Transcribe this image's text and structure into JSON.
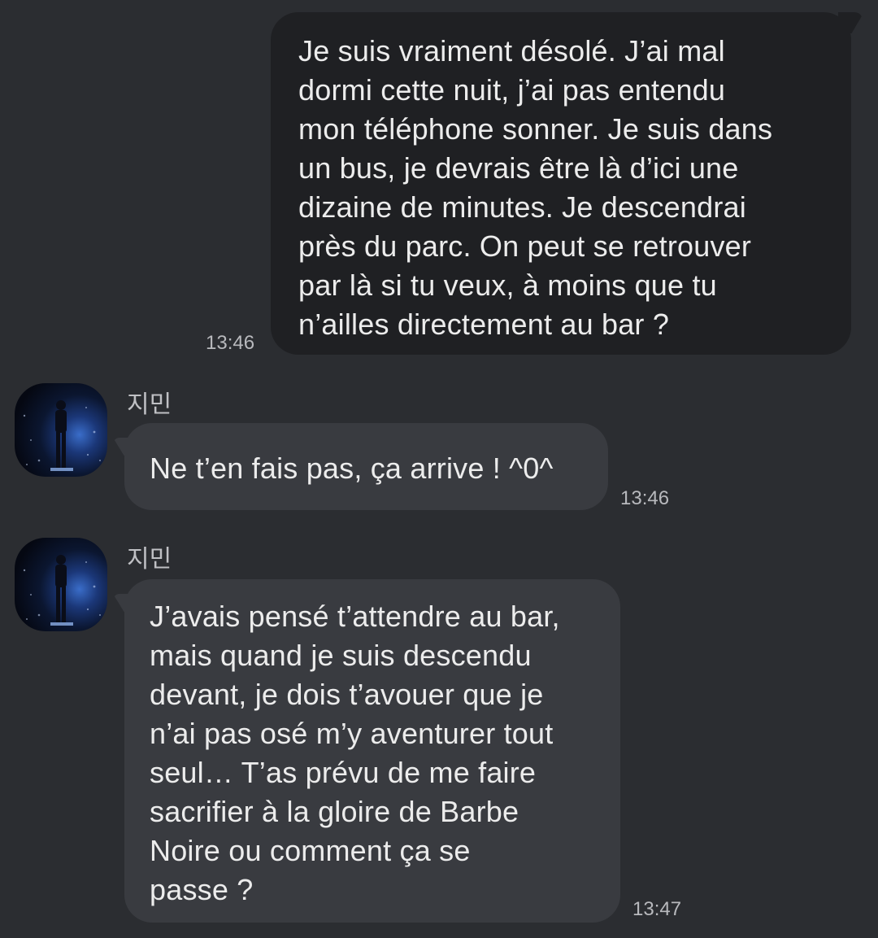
{
  "conversation": {
    "messages": [
      {
        "direction": "outgoing",
        "text": "Je suis vraiment désolé. J’ai mal\ndormi cette nuit, j’ai pas entendu\nmon téléphone sonner. Je suis dans\nun bus, je devrais être là d’ici une\ndizaine de minutes. Je descendrai\nprès du parc. On peut se retrouver\npar là si tu veux, à moins que tu\nn’ailles directement au bar ?",
        "time": "13:46"
      },
      {
        "direction": "incoming",
        "sender": "지민",
        "avatar_icon": "profile-avatar-icon",
        "text": "Ne t’en fais pas, ça arrive ! ^0^",
        "time": "13:46"
      },
      {
        "direction": "incoming",
        "sender": "지민",
        "avatar_icon": "profile-avatar-icon",
        "text": "J’avais pensé t’attendre au bar,\nmais quand je suis descendu\ndevant, je dois t’avouer que je\nn’ai pas osé m’y aventurer tout\nseul… T’as prévu de me faire\nsacrifier à la gloire de Barbe\nNoire ou comment ça se\npasse ?",
        "time": "13:47"
      }
    ]
  },
  "colors": {
    "background": "#2b2d31",
    "outgoing_bubble": "#1f2023",
    "incoming_bubble": "#393b40",
    "text": "#ececec",
    "timestamp": "#b8b9bd"
  }
}
